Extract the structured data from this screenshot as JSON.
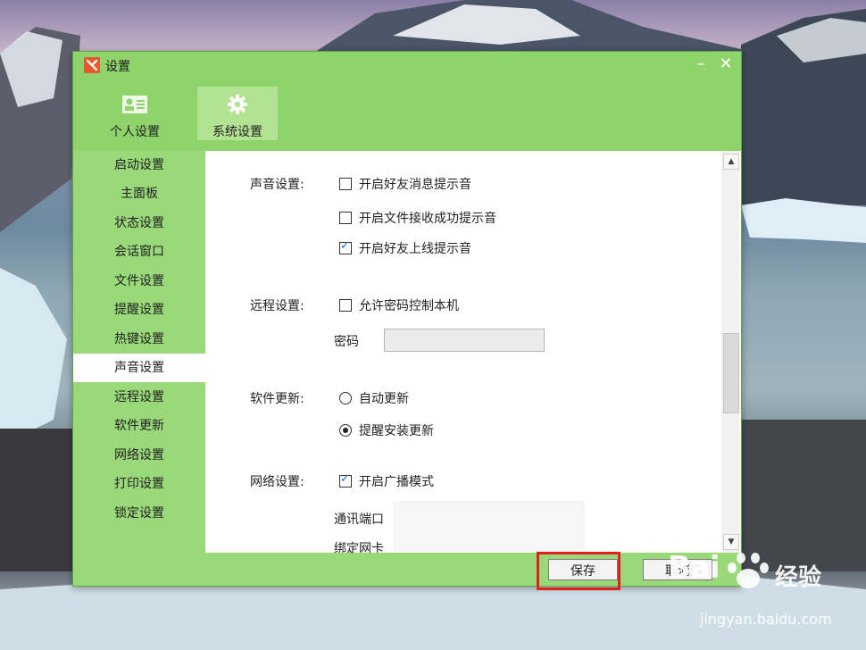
{
  "window": {
    "title": "设置",
    "minimize": "–",
    "close": "✕"
  },
  "toolbar": {
    "tabs": [
      {
        "label": "个人设置",
        "icon": "contact-card-icon"
      },
      {
        "label": "系统设置",
        "icon": "gear-icon",
        "active": true
      }
    ]
  },
  "sidebar": {
    "items": [
      {
        "label": "启动设置"
      },
      {
        "label": "主面板"
      },
      {
        "label": "状态设置"
      },
      {
        "label": "会话窗口"
      },
      {
        "label": "文件设置"
      },
      {
        "label": "提醒设置"
      },
      {
        "label": "热键设置"
      },
      {
        "label": "声音设置",
        "active": true
      },
      {
        "label": "远程设置"
      },
      {
        "label": "软件更新"
      },
      {
        "label": "网络设置"
      },
      {
        "label": "打印设置"
      },
      {
        "label": "锁定设置"
      }
    ]
  },
  "content": {
    "sound": {
      "label": "声音设置:",
      "options": [
        {
          "text": "开启好友消息提示音",
          "checked": false
        },
        {
          "text": "开启文件接收成功提示音",
          "checked": false
        },
        {
          "text": "开启好友上线提示音",
          "checked": true
        }
      ]
    },
    "remote": {
      "label": "远程设置:",
      "option": {
        "text": "允许密码控制本机",
        "checked": false
      },
      "password_label": "密码",
      "password_value": ""
    },
    "update": {
      "label": "软件更新:",
      "options": [
        {
          "text": "自动更新",
          "selected": false
        },
        {
          "text": "提醒安装更新",
          "selected": true
        }
      ]
    },
    "network": {
      "label": "网络设置:",
      "option": {
        "text": "开启广播模式",
        "checked": true
      },
      "port_label": "通讯端口",
      "nic_label": "绑定网卡"
    }
  },
  "buttons": {
    "save": "保存",
    "cancel": "取消"
  },
  "watermark": {
    "brand": "Bai",
    "brand2": "经验",
    "url": "jingyan.baidu.com"
  },
  "colors": {
    "accent": "#8ed46a",
    "sidebar": "#9ad979",
    "annotation": "#e32020"
  }
}
